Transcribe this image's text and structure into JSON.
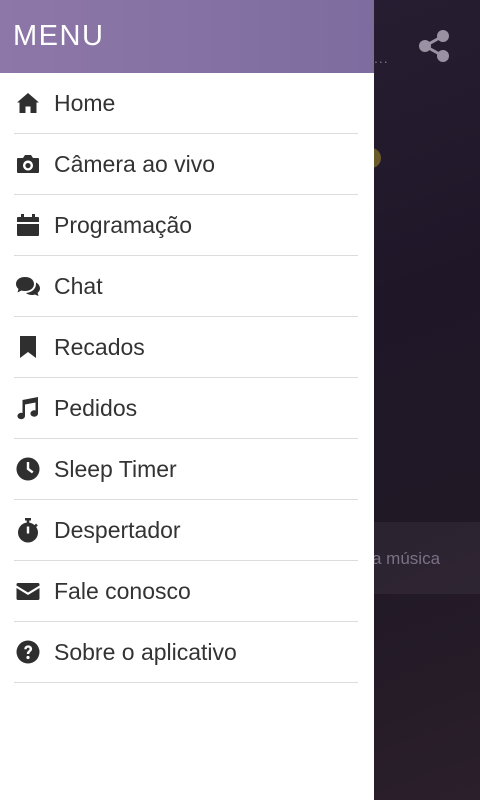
{
  "drawer": {
    "title": "MENU",
    "items": [
      {
        "label": "Home",
        "icon": "home-icon"
      },
      {
        "label": "Câmera ao vivo",
        "icon": "camera-icon"
      },
      {
        "label": "Programação",
        "icon": "calendar-icon"
      },
      {
        "label": "Chat",
        "icon": "chat-icon"
      },
      {
        "label": "Recados",
        "icon": "bookmark-icon"
      },
      {
        "label": "Pedidos",
        "icon": "music-note-icon"
      },
      {
        "label": "Sleep Timer",
        "icon": "clock-icon"
      },
      {
        "label": "Despertador",
        "icon": "stopwatch-icon"
      },
      {
        "label": "Fale conosco",
        "icon": "envelope-icon"
      },
      {
        "label": "Sobre o aplicativo",
        "icon": "question-circle-icon"
      }
    ]
  },
  "background": {
    "dots": "...",
    "partial_text": "a música",
    "share_icon": "share-icon"
  },
  "colors": {
    "header_gradient_start": "#8d77a8",
    "header_gradient_end": "#7e6c9f",
    "icon_color": "#2f2f2f",
    "text_color": "#333333",
    "divider": "#dcdcdc"
  }
}
